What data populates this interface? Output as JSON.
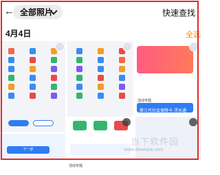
{
  "topbar": {
    "back_icon": "←",
    "album_label": "全部照片",
    "quick_find": "快速查找"
  },
  "date_header": "4月4日",
  "select_all": "全选",
  "labels": {
    "next_btn": "下一步",
    "tele_banner": "第三代社会保障卡·浮水通",
    "section_a": "活动专题",
    "section_b": "活动专题",
    "watermark_big": "当下软件园",
    "watermark_url": "www.downxia.com"
  },
  "colors": {
    "accent_blue": "#2f7cf6",
    "frame_red": "#e8262a",
    "select_orange": "#ff8a00"
  }
}
